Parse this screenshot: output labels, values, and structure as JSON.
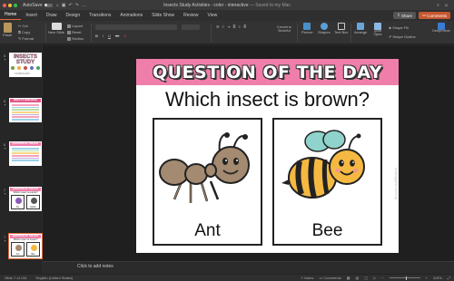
{
  "titlebar": {
    "autosave_label": "AutoSave",
    "autosave_state": "OFF",
    "doc_name": "Insects Study Activities - color - interactive",
    "doc_status": "— Saved to my Mac",
    "window_dots": [
      "#ff5f57",
      "#febc2e",
      "#28c840"
    ]
  },
  "ribbon_tabs": [
    "Home",
    "Insert",
    "Draw",
    "Design",
    "Transitions",
    "Animations",
    "Slide Show",
    "Review",
    "View"
  ],
  "active_tab": "Home",
  "share_label": "Share",
  "comments_label": "Comments",
  "ribbon": {
    "paste": "Paste",
    "cut": "Cut",
    "copy": "Copy",
    "format": "Format",
    "new_slide": "New Slide",
    "layout": "Layout",
    "reset": "Reset",
    "section": "Section",
    "convert_smartart": "Convert to SmartArt",
    "picture": "Picture",
    "shapes": "Shapes",
    "text_box": "Text Box",
    "arrange": "Arrange",
    "quick_styles": "Quick Styles",
    "shape_fill": "Shape Fill",
    "shape_outline": "Shape Outline",
    "design_ideas": "Design Ideas"
  },
  "slides": [
    {
      "num": "5",
      "title": "INSECTS STUDY",
      "sub": "CATEPILLARS"
    },
    {
      "num": "6",
      "title": "INSECT'S RESEARCH"
    },
    {
      "num": "6",
      "title": "QUESTION OF THE DAY"
    },
    {
      "num": "7",
      "title": "QUESTION OF THE DAY",
      "question": "Which insect is purple?",
      "left": "Fly",
      "right": "Spider"
    },
    {
      "num": "7",
      "title": "QUESTION OF THE DAY",
      "question": "Which insect is brown?",
      "left": "Ant",
      "right": "Bee"
    }
  ],
  "slide": {
    "banner": "QUESTION OF THE DAY",
    "question": "Which insect is brown?",
    "left_label": "Ant",
    "right_label": "Bee",
    "watermark": "Kinderglyphs Learning"
  },
  "notes_placeholder": "Click to add notes",
  "status": {
    "slide_count": "Slide 7 of 134",
    "language": "English (United States)",
    "notes": "Notes",
    "comments": "Comments",
    "zoom": "115%"
  },
  "colors": {
    "banner": "#f07eaa",
    "accent": "#e36c3b",
    "ant": "#a38a70",
    "bee_yellow": "#f5b942",
    "bee_wing": "#8fd3cc"
  }
}
